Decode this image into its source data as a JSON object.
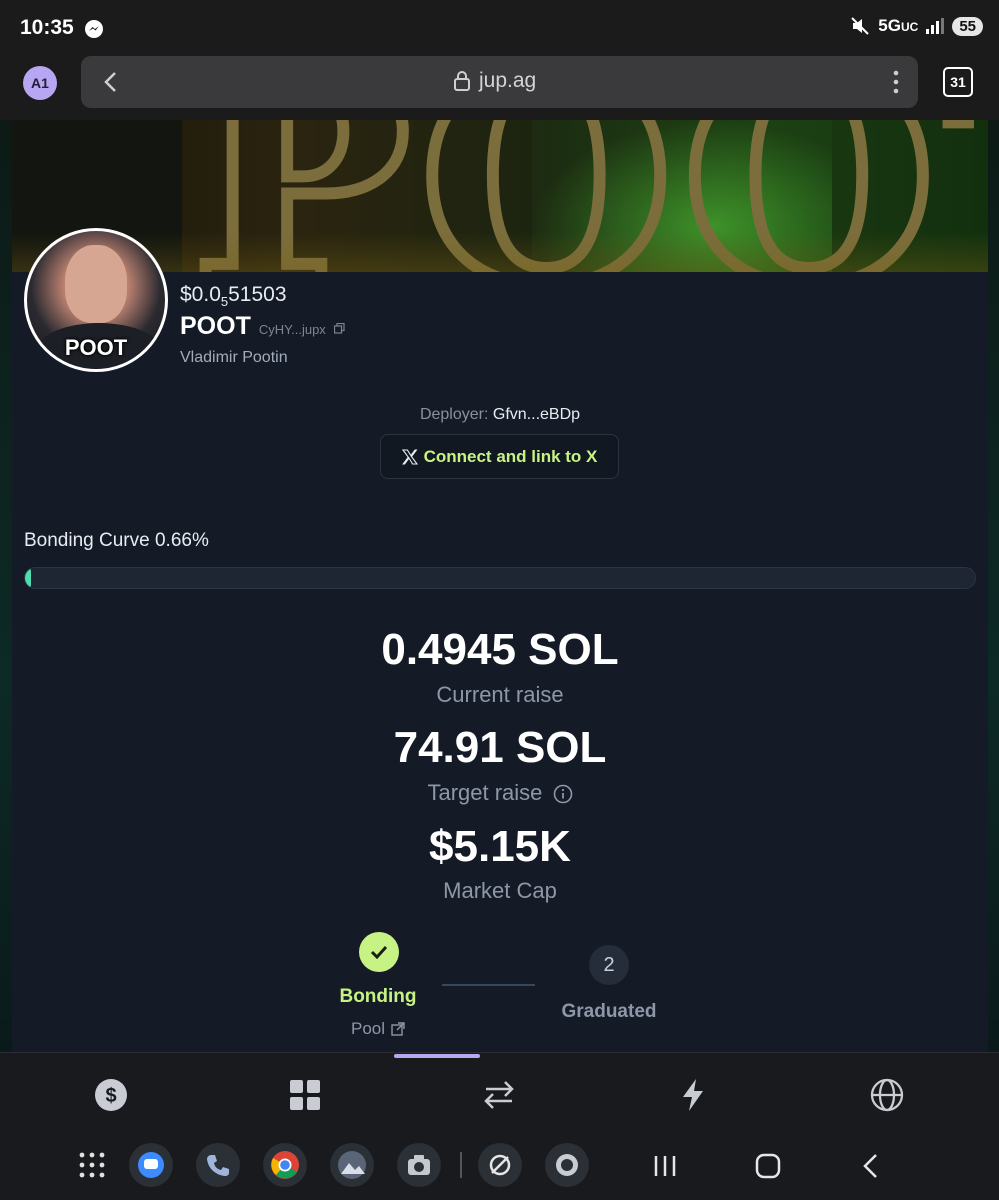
{
  "status_bar": {
    "time": "10:35",
    "network": "5G",
    "network_suffix": "UC",
    "battery": "55"
  },
  "browser": {
    "profile_initials": "A1",
    "url": "jup.ag",
    "tab_count": "31"
  },
  "token": {
    "price_prefix": "$0.0",
    "price_subscript": "5",
    "price_suffix": "51503",
    "ticker": "POOT",
    "address": "CyHY...jupx",
    "name": "Vladimir Pootin",
    "avatar_label": "POOT",
    "deployer_label": "Deployer:",
    "deployer_value": "Gfvn...eBDp",
    "connect_label": "Connect and link to X"
  },
  "bonding_curve": {
    "label": "Bonding Curve 0.66%",
    "progress_percent": 0.66
  },
  "stats": {
    "current_raise_value": "0.4945 SOL",
    "current_raise_label": "Current raise",
    "target_raise_value": "74.91 SOL",
    "target_raise_label": "Target raise",
    "market_cap_value": "$5.15K",
    "market_cap_label": "Market Cap"
  },
  "steps": {
    "step1_label": "Bonding",
    "step1_sub": "Pool",
    "step2_number": "2",
    "step2_label": "Graduated"
  },
  "app_tabs": [
    "dollar-icon",
    "grid-icon",
    "swap-icon",
    "lightning-icon",
    "globe-icon"
  ],
  "colors": {
    "accent_green": "#c7f284",
    "progress_teal": "#4fdcb0",
    "nav_indicator": "#b7a6f2"
  }
}
